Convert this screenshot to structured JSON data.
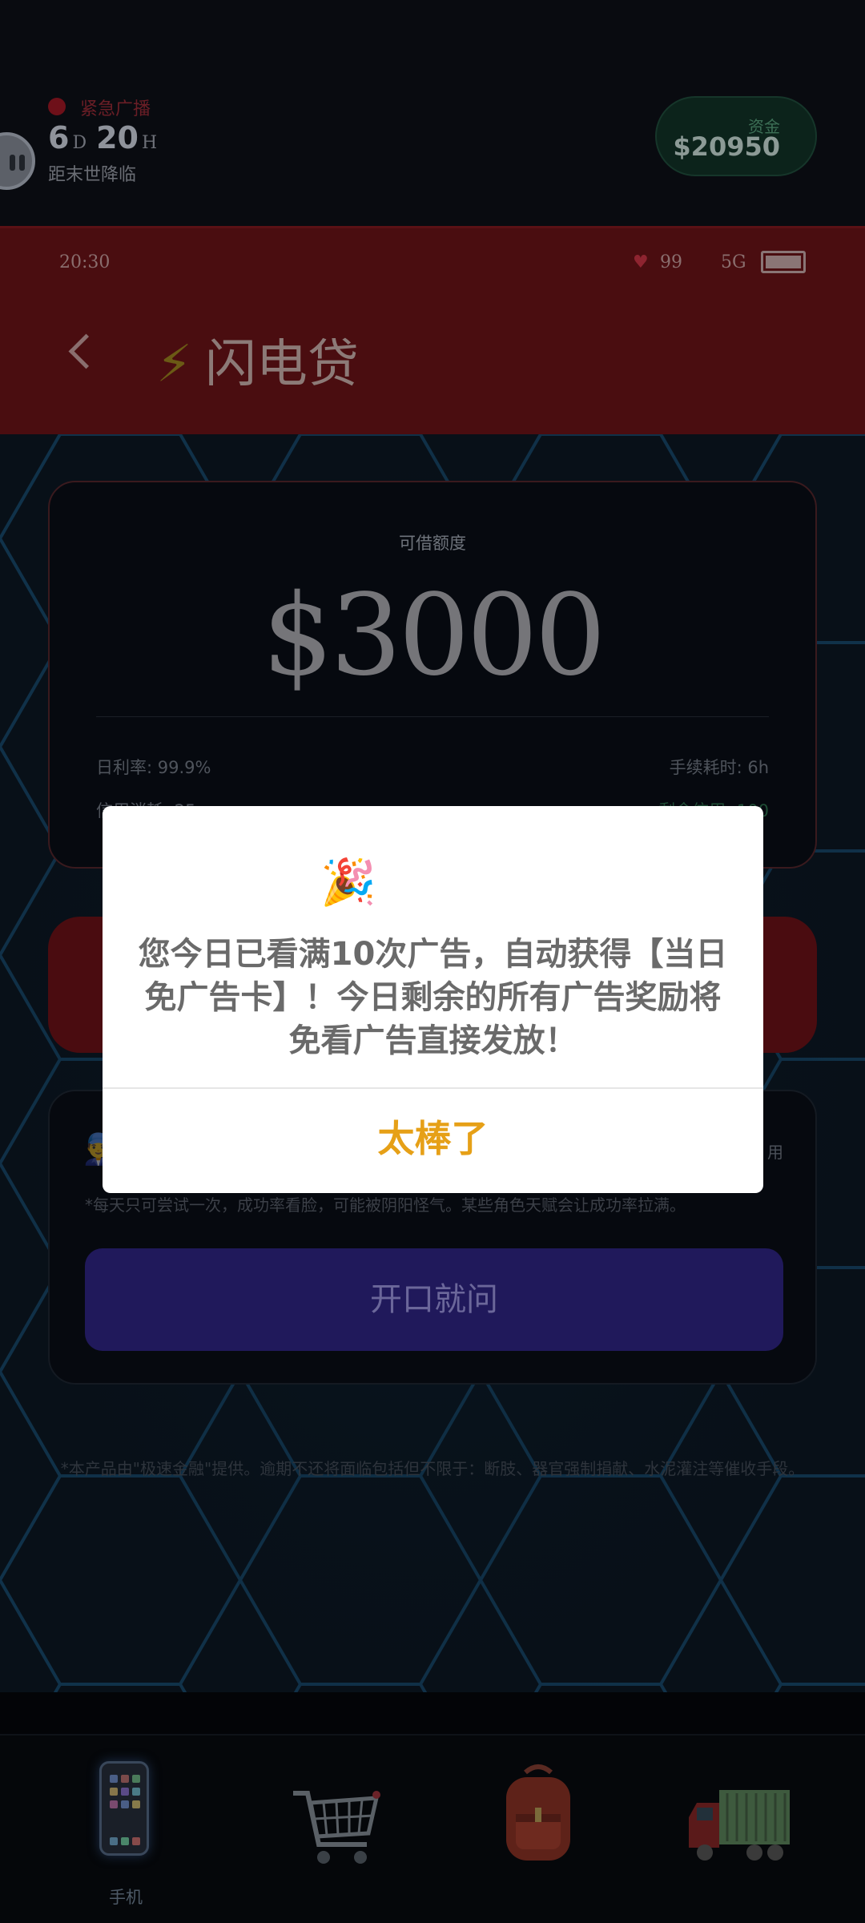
{
  "hud": {
    "broadcast_label": "紧急广播",
    "countdown_days": "6",
    "countdown_days_unit": "D",
    "countdown_hours": "20",
    "countdown_hours_unit": "H",
    "countdown_caption": "距末世降临",
    "funds_label": "资金",
    "funds_value": "$20950"
  },
  "status_bar": {
    "time": "20:30",
    "heart_icon": "♥",
    "battery_value": "99",
    "signal": "5G"
  },
  "app_header": {
    "bolt_icon": "⚡",
    "title": "闪电贷"
  },
  "loan_card": {
    "limit_label": "可借额度",
    "limit_value": "$3000",
    "daily_rate": "日利率: 99.9%",
    "fee_time": "手续耗时: 6h",
    "credit_cost": "信用消耗: 25",
    "remaining_credit": "剩余信用: 100"
  },
  "ask_card": {
    "right_text": "用",
    "note": "*每天只可尝试一次，成功率看脸，可能被阴阳怪气。某些角色天赋会让成功率拉满。",
    "button_label": "开口就问"
  },
  "disclaimer": "*本产品由\"极速金融\"提供。逾期不还将面临包括但不限于：断肢、器官强制捐献、水泥灌注等催收手段。",
  "bottom_nav": {
    "items": [
      {
        "label": "手机",
        "icon": "phone-icon"
      },
      {
        "label": "",
        "icon": "cart-icon"
      },
      {
        "label": "",
        "icon": "backpack-icon"
      },
      {
        "label": "",
        "icon": "truck-icon"
      }
    ]
  },
  "dialog": {
    "emoji": "🎉",
    "message": "您今日已看满10次广告，自动获得【当日免广告卡】！今日剩余的所有广告奖励将免看广告直接发放！",
    "confirm_label": "太棒了"
  },
  "colors": {
    "dialog_button": "#e6a017",
    "header_red": "#4a0d10",
    "ask_button": "#20195b"
  }
}
